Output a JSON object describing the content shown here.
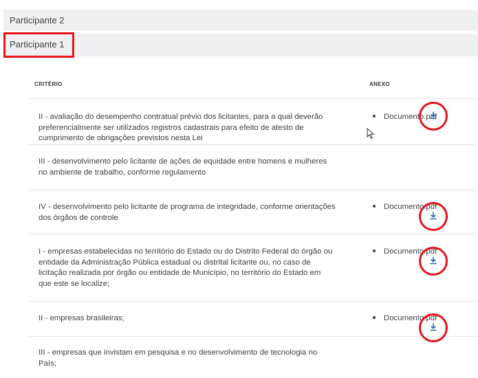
{
  "accordion": {
    "participant2": "Participante 2",
    "participant1": "Participante 1"
  },
  "table": {
    "headers": {
      "criterion": "CRITÉRIO",
      "attachment": "ANEXO"
    },
    "rows": [
      {
        "criterion": "II - avaliação do desempenho contratual prévio dos licitantes, para a qual deverão preferencialmente ser utilizados registros cadastrais para efeito de atesto de cumprimento de obrigações previstos nesta Lei",
        "attachment": "Documento.pdf"
      },
      {
        "criterion": "III - desenvolvimento pelo licitante de ações de equidade entre homens e mulheres no ambiente de trabalho, conforme regulamento",
        "attachment": ""
      },
      {
        "criterion": "IV - desenvolvimento pelo licitante de programa de integridade, conforme orientações dos órgãos de controle",
        "attachment": "Documento.pdf"
      },
      {
        "criterion": "I - empresas estabelecidas no território do Estado ou do Distrito Federal do órgão ou entidade da Administração Pública estadual ou distrital licitante ou, no caso de licitação realizada por órgão ou entidade de Município, no território do Estado em que este se localize;",
        "attachment": "Documento.pdf"
      },
      {
        "criterion": "II - empresas brasileiras;",
        "attachment": "Documento.pdf"
      },
      {
        "criterion": "III - empresas que invistam em pesquisa e no desenvolvimento de tecnologia no País;",
        "attachment": ""
      }
    ]
  },
  "colors": {
    "highlight": "#e8121b",
    "accent": "#2f66b3",
    "header_bg": "#eef0f2"
  },
  "icons": {
    "download": "download-icon",
    "cursor": "mouse-pointer-icon"
  }
}
